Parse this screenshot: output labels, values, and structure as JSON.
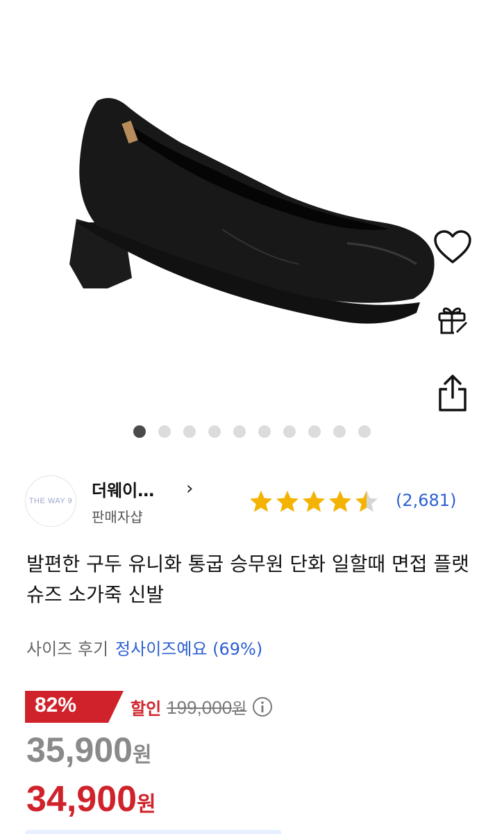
{
  "product": {
    "images": {
      "count": 10,
      "active_index": 0
    },
    "title": "발편한 구두 유니화 통굽 승무원 단화 일할때 면접 플랫슈즈 소가죽 신발"
  },
  "actions": {
    "like_icon": "heart-icon",
    "gift_icon": "gift-icon",
    "share_icon": "share-icon"
  },
  "seller": {
    "logo_text": "THE WAY 9",
    "name": "더웨이…",
    "role": "판매자샵",
    "chevron": "›"
  },
  "rating": {
    "stars": 4.5,
    "count_text": "(2,681)",
    "star_color": "#f5b301"
  },
  "size_review": {
    "label": "사이즈 후기",
    "value": "정사이즈예요 (69%)"
  },
  "pricing": {
    "discount_percent": "82%",
    "discount_label": "할인",
    "original_price": "199,000",
    "original_unit": "원",
    "price": "35,900",
    "price_unit": "원",
    "final_price": "34,900",
    "final_unit": "원",
    "accent_color": "#d0222a"
  }
}
